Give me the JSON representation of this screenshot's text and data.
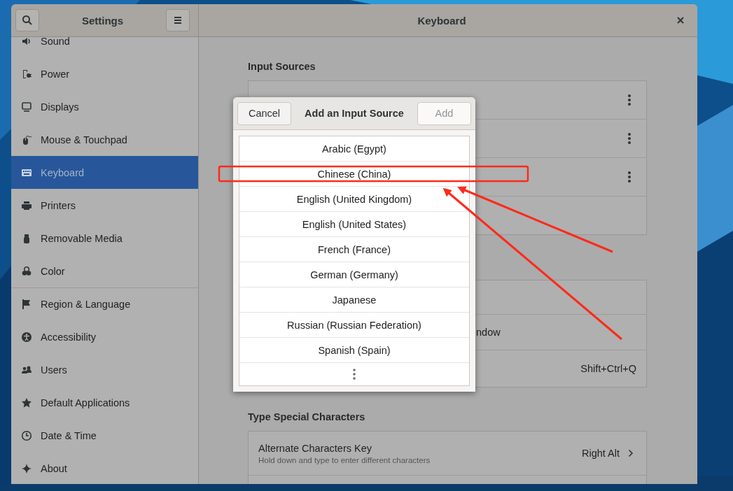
{
  "window": {
    "sidebar_title": "Settings",
    "title": "Keyboard"
  },
  "sidebar": {
    "items": [
      {
        "label": "Sound",
        "selected": false
      },
      {
        "label": "Power",
        "selected": false
      },
      {
        "label": "Displays",
        "selected": false
      },
      {
        "label": "Mouse & Touchpad",
        "selected": false
      },
      {
        "label": "Keyboard",
        "selected": true
      },
      {
        "label": "Printers",
        "selected": false
      },
      {
        "label": "Removable Media",
        "selected": false
      },
      {
        "label": "Color",
        "selected": false
      },
      {
        "label": "Region & Language",
        "selected": false
      },
      {
        "label": "Accessibility",
        "selected": false
      },
      {
        "label": "Users",
        "selected": false
      },
      {
        "label": "Default Applications",
        "selected": false
      },
      {
        "label": "Date & Time",
        "selected": false
      },
      {
        "label": "About",
        "selected": false
      }
    ]
  },
  "input_sources": {
    "heading": "Input Sources",
    "rows": [
      {
        "kind": "source"
      },
      {
        "kind": "source"
      },
      {
        "kind": "source"
      },
      {
        "kind": "blank"
      }
    ]
  },
  "shortcuts": {
    "rows": [
      {
        "kind": "blank"
      },
      {
        "kind": "label",
        "label": "ndow"
      },
      {
        "kind": "shortcut",
        "value": "Shift+Ctrl+Q"
      }
    ]
  },
  "special_characters": {
    "heading": "Type Special Characters",
    "rows": [
      {
        "kind": "setting",
        "title": "Alternate Characters Key",
        "subtitle": "Hold down and type to enter different characters",
        "value": "Right Alt"
      },
      {
        "kind": "blank"
      }
    ]
  },
  "dialog": {
    "title": "Add an Input Source",
    "cancel": "Cancel",
    "add": {
      "label": "Add",
      "disabled": true
    },
    "has_more": true,
    "languages": [
      {
        "label": "Arabic (Egypt)",
        "selected": false
      },
      {
        "label": "Chinese (China)",
        "selected": false
      },
      {
        "label": "English (United Kingdom)",
        "selected": false
      },
      {
        "label": "English (United States)",
        "selected": false
      },
      {
        "label": "French (France)",
        "selected": false
      },
      {
        "label": "German (Germany)",
        "selected": false
      },
      {
        "label": "Japanese",
        "selected": false
      },
      {
        "label": "Russian (Russian Federation)",
        "selected": false
      },
      {
        "label": "Spanish (Spain)",
        "selected": false
      }
    ]
  },
  "annotations": [
    {
      "kind": "highlight-box"
    },
    {
      "kind": "arrow"
    },
    {
      "kind": "arrow"
    }
  ]
}
